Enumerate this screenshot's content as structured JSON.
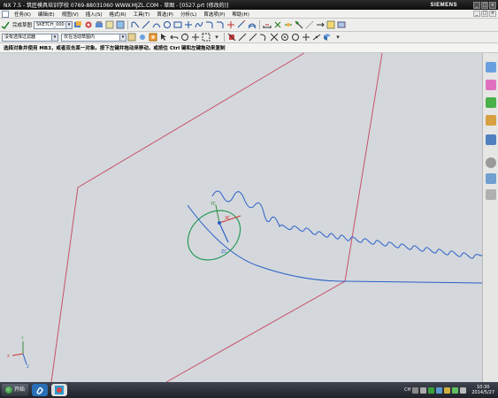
{
  "window": {
    "title": "NX 7.5 - 筑匠模具培训学校    0769-88031060  WWW.MJZL.COM - 草图 - [0527.prt (修改的)]",
    "brand": "SIEMENS",
    "controls": [
      "_",
      "□",
      "×"
    ]
  },
  "menubar": {
    "items": [
      "任务(K)",
      "编辑(E)",
      "视图(V)",
      "插入(S)",
      "格式(R)",
      "工具(T)",
      "首选(P)",
      "分析(L)",
      "首选项(P)",
      "帮助(H)"
    ],
    "doc_controls": [
      "_",
      "□",
      "×"
    ]
  },
  "toolbar1": {
    "finish_sketch_label": "完成草图",
    "sketch_name": "SKETCH_000"
  },
  "toolbar2": {
    "selection_filter": "没有选择过滤器",
    "assembly_scope": "仅在活动草图内"
  },
  "status": {
    "message": "选择对象并使用 MB3，或者双击某一对象。按下左键并拖动来移动，或按住 Ctrl 键和左键拖动来复制"
  },
  "viewport": {
    "csys_labels": {
      "x": "XC",
      "y": "YC",
      "z": "ZC"
    },
    "triad_labels": {
      "x": "X",
      "y": "Y",
      "z": "Z"
    }
  },
  "taskbar": {
    "start_label": "开始",
    "tray_lang": "CH",
    "time": "10:30",
    "date": "2014/5/27"
  },
  "colors": {
    "sketch_plane": "#c8506a",
    "curve": "#2a5fc8",
    "csys_ring": "#2a9a5a",
    "background": "#d4d8dc"
  }
}
